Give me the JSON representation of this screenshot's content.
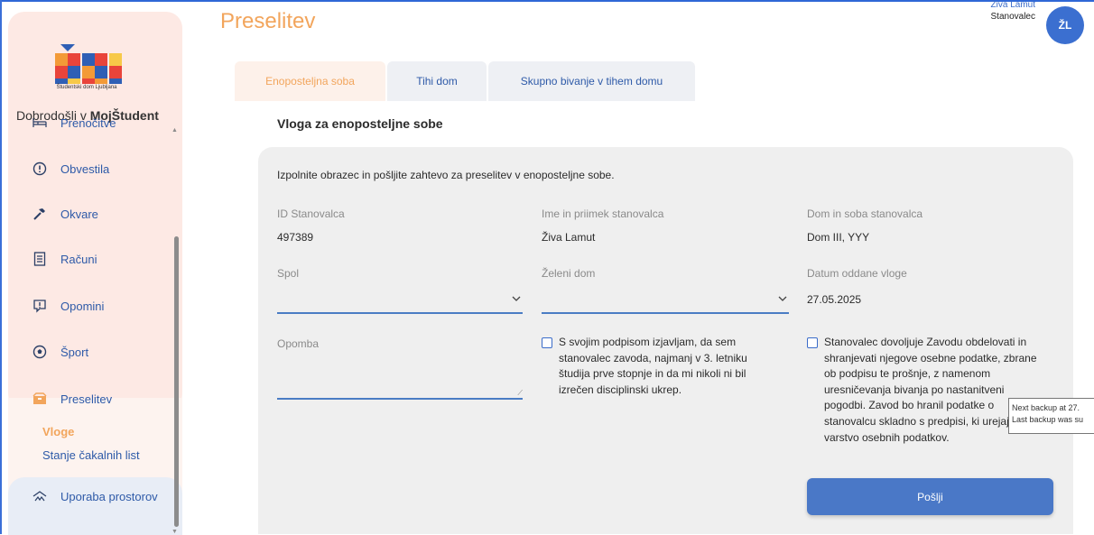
{
  "header": {
    "page_title": "Preselitev",
    "user_name": "Živa Lamut",
    "user_role": "Stanovalec",
    "avatar_initials": "ŽL"
  },
  "sidebar": {
    "logo_text": "Študentski dom Ljubljana",
    "welcome_prefix": "Dobrodošli v ",
    "welcome_brand": "MojŠtudent",
    "items": [
      {
        "label": "Prenočitve",
        "icon": "bed-icon"
      },
      {
        "label": "Obvestila",
        "icon": "alert-circle-icon"
      },
      {
        "label": "Okvare",
        "icon": "hammer-icon"
      },
      {
        "label": "Računi",
        "icon": "receipt-icon"
      },
      {
        "label": "Opomini",
        "icon": "warning-message-icon"
      },
      {
        "label": "Šport",
        "icon": "ball-icon"
      },
      {
        "label": "Preselitev",
        "icon": "moving-box-icon"
      },
      {
        "label": "Uporaba prostorov",
        "icon": "building-icon"
      }
    ],
    "sub_items": [
      {
        "label": "Vloge",
        "active": true
      },
      {
        "label": "Stanje čakalnih list",
        "active": false
      }
    ]
  },
  "tabs": [
    {
      "label": "Enoposteljna soba",
      "active": true
    },
    {
      "label": "Tihi dom",
      "active": false
    },
    {
      "label": "Skupno bivanje v tihem domu",
      "active": false
    }
  ],
  "form": {
    "heading": "Vloga za enoposteljne sobe",
    "intro": "Izpolnite obrazec in pošljite zahtevo za preselitev v enoposteljne sobe.",
    "fields": {
      "id_label": "ID Stanovalca",
      "id_value": "497389",
      "name_label": "Ime in priimek stanovalca",
      "name_value": "Živa Lamut",
      "room_label": "Dom in soba stanovalca",
      "room_value": "Dom III, YYY",
      "gender_label": "Spol",
      "gender_value": "",
      "dorm_label": "Želeni dom",
      "dorm_value": "",
      "date_label": "Datum oddane vloge",
      "date_value": "27.05.2025",
      "note_label": "Opomba",
      "note_value": ""
    },
    "checkbox1_lines": [
      "S svojim podpisom izjavljam, da sem",
      "stanovalec zavoda, najmanj v 3. letniku",
      "študija prve stopnje in da mi nikoli ni bil",
      "izrečen disciplinski ukrep."
    ],
    "checkbox2_lines": [
      "Stanovalec dovoljuje Zavodu obdelovati in",
      "shranjevati njegove osebne podatke, zbrane",
      "ob podpisu te prošnje, z namenom",
      "uresničevanja bivanja po nastanitveni",
      "pogodbi. Zavod bo hranil podatke o",
      "stanovalcu skladno s predpisi, ki urejajo",
      "varstvo osebnih podatkov."
    ],
    "submit_label": "Pošlji"
  },
  "tooltip": {
    "line1": "Next backup at 27.",
    "line2": "Last backup was su"
  },
  "colors": {
    "accent_orange": "#f2a55c",
    "accent_blue": "#4a78c7",
    "sidebar_pink": "#fde9e4"
  }
}
